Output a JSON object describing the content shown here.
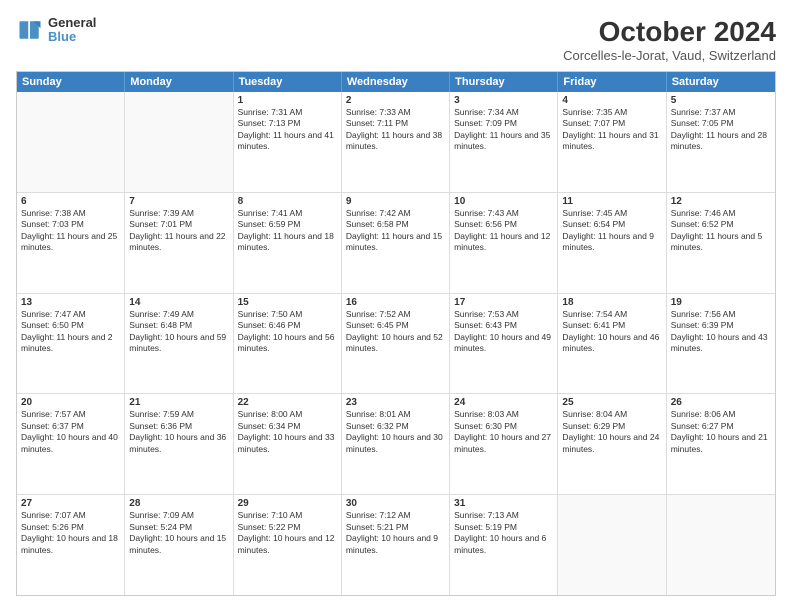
{
  "logo": {
    "line1": "General",
    "line2": "Blue"
  },
  "title": "October 2024",
  "subtitle": "Corcelles-le-Jorat, Vaud, Switzerland",
  "days": [
    "Sunday",
    "Monday",
    "Tuesday",
    "Wednesday",
    "Thursday",
    "Friday",
    "Saturday"
  ],
  "rows": [
    [
      {
        "day": "",
        "content": "",
        "empty": true
      },
      {
        "day": "",
        "content": "",
        "empty": true
      },
      {
        "day": "1",
        "content": "Sunrise: 7:31 AM\nSunset: 7:13 PM\nDaylight: 11 hours and 41 minutes."
      },
      {
        "day": "2",
        "content": "Sunrise: 7:33 AM\nSunset: 7:11 PM\nDaylight: 11 hours and 38 minutes."
      },
      {
        "day": "3",
        "content": "Sunrise: 7:34 AM\nSunset: 7:09 PM\nDaylight: 11 hours and 35 minutes."
      },
      {
        "day": "4",
        "content": "Sunrise: 7:35 AM\nSunset: 7:07 PM\nDaylight: 11 hours and 31 minutes."
      },
      {
        "day": "5",
        "content": "Sunrise: 7:37 AM\nSunset: 7:05 PM\nDaylight: 11 hours and 28 minutes."
      }
    ],
    [
      {
        "day": "6",
        "content": "Sunrise: 7:38 AM\nSunset: 7:03 PM\nDaylight: 11 hours and 25 minutes."
      },
      {
        "day": "7",
        "content": "Sunrise: 7:39 AM\nSunset: 7:01 PM\nDaylight: 11 hours and 22 minutes."
      },
      {
        "day": "8",
        "content": "Sunrise: 7:41 AM\nSunset: 6:59 PM\nDaylight: 11 hours and 18 minutes."
      },
      {
        "day": "9",
        "content": "Sunrise: 7:42 AM\nSunset: 6:58 PM\nDaylight: 11 hours and 15 minutes."
      },
      {
        "day": "10",
        "content": "Sunrise: 7:43 AM\nSunset: 6:56 PM\nDaylight: 11 hours and 12 minutes."
      },
      {
        "day": "11",
        "content": "Sunrise: 7:45 AM\nSunset: 6:54 PM\nDaylight: 11 hours and 9 minutes."
      },
      {
        "day": "12",
        "content": "Sunrise: 7:46 AM\nSunset: 6:52 PM\nDaylight: 11 hours and 5 minutes."
      }
    ],
    [
      {
        "day": "13",
        "content": "Sunrise: 7:47 AM\nSunset: 6:50 PM\nDaylight: 11 hours and 2 minutes."
      },
      {
        "day": "14",
        "content": "Sunrise: 7:49 AM\nSunset: 6:48 PM\nDaylight: 10 hours and 59 minutes."
      },
      {
        "day": "15",
        "content": "Sunrise: 7:50 AM\nSunset: 6:46 PM\nDaylight: 10 hours and 56 minutes."
      },
      {
        "day": "16",
        "content": "Sunrise: 7:52 AM\nSunset: 6:45 PM\nDaylight: 10 hours and 52 minutes."
      },
      {
        "day": "17",
        "content": "Sunrise: 7:53 AM\nSunset: 6:43 PM\nDaylight: 10 hours and 49 minutes."
      },
      {
        "day": "18",
        "content": "Sunrise: 7:54 AM\nSunset: 6:41 PM\nDaylight: 10 hours and 46 minutes."
      },
      {
        "day": "19",
        "content": "Sunrise: 7:56 AM\nSunset: 6:39 PM\nDaylight: 10 hours and 43 minutes."
      }
    ],
    [
      {
        "day": "20",
        "content": "Sunrise: 7:57 AM\nSunset: 6:37 PM\nDaylight: 10 hours and 40 minutes."
      },
      {
        "day": "21",
        "content": "Sunrise: 7:59 AM\nSunset: 6:36 PM\nDaylight: 10 hours and 36 minutes."
      },
      {
        "day": "22",
        "content": "Sunrise: 8:00 AM\nSunset: 6:34 PM\nDaylight: 10 hours and 33 minutes."
      },
      {
        "day": "23",
        "content": "Sunrise: 8:01 AM\nSunset: 6:32 PM\nDaylight: 10 hours and 30 minutes."
      },
      {
        "day": "24",
        "content": "Sunrise: 8:03 AM\nSunset: 6:30 PM\nDaylight: 10 hours and 27 minutes."
      },
      {
        "day": "25",
        "content": "Sunrise: 8:04 AM\nSunset: 6:29 PM\nDaylight: 10 hours and 24 minutes."
      },
      {
        "day": "26",
        "content": "Sunrise: 8:06 AM\nSunset: 6:27 PM\nDaylight: 10 hours and 21 minutes."
      }
    ],
    [
      {
        "day": "27",
        "content": "Sunrise: 7:07 AM\nSunset: 5:26 PM\nDaylight: 10 hours and 18 minutes."
      },
      {
        "day": "28",
        "content": "Sunrise: 7:09 AM\nSunset: 5:24 PM\nDaylight: 10 hours and 15 minutes."
      },
      {
        "day": "29",
        "content": "Sunrise: 7:10 AM\nSunset: 5:22 PM\nDaylight: 10 hours and 12 minutes."
      },
      {
        "day": "30",
        "content": "Sunrise: 7:12 AM\nSunset: 5:21 PM\nDaylight: 10 hours and 9 minutes."
      },
      {
        "day": "31",
        "content": "Sunrise: 7:13 AM\nSunset: 5:19 PM\nDaylight: 10 hours and 6 minutes."
      },
      {
        "day": "",
        "content": "",
        "empty": true
      },
      {
        "day": "",
        "content": "",
        "empty": true
      }
    ]
  ]
}
